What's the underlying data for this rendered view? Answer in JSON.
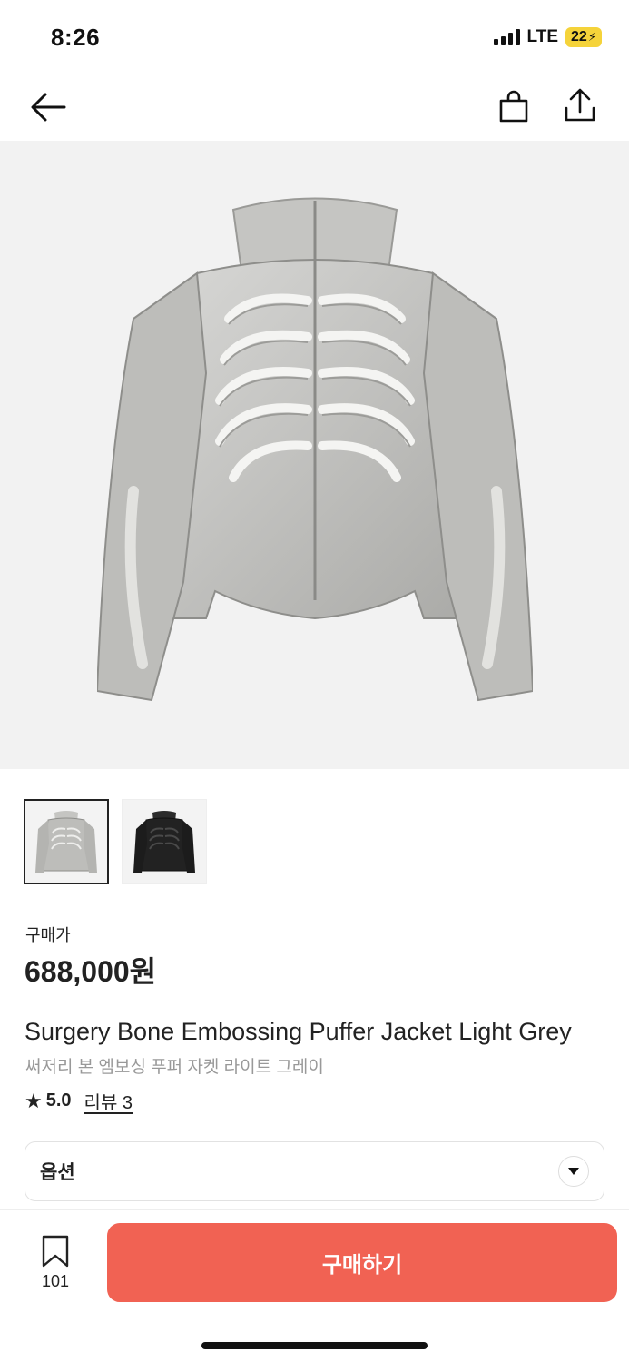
{
  "status_bar": {
    "time": "8:26",
    "network": "LTE",
    "battery": "22"
  },
  "nav": {
    "back_icon": "arrow-left-icon",
    "bag_icon": "shopping-bag-icon",
    "share_icon": "share-icon"
  },
  "product": {
    "image_description_icon": "jacket-photo",
    "thumbnails": [
      {
        "color": "light-grey",
        "selected": true
      },
      {
        "color": "black",
        "selected": false
      }
    ],
    "price_label": "구매가",
    "price": "688,000원",
    "title_en": "Surgery Bone Embossing Puffer Jacket Light Grey",
    "title_ko": "써저리 본 엠보싱 푸퍼 자켓 라이트 그레이",
    "rating": "5.0",
    "review_link": "리뷰 3"
  },
  "option": {
    "label": "옵션"
  },
  "bottom_bar": {
    "wish_count": "101",
    "buy_label": "구매하기"
  },
  "colors": {
    "accent": "#f16253",
    "battery": "#f5d33a",
    "hero_bg": "#f2f2f2"
  }
}
